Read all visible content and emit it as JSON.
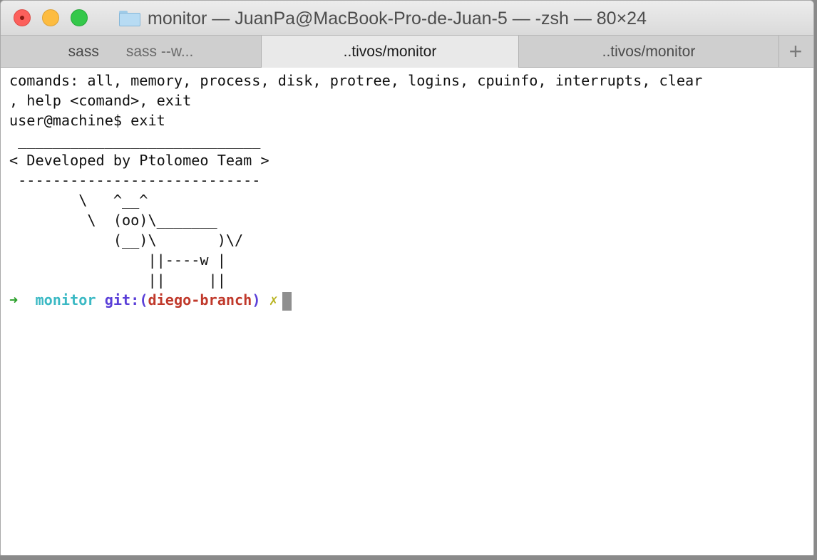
{
  "window": {
    "title": "monitor — JuanPa@MacBook-Pro-de-Juan-5 — -zsh — 80×24"
  },
  "tabs": [
    {
      "label": "sass",
      "sublabel": "sass --w...",
      "active": false
    },
    {
      "label": "..tivos/monitor",
      "active": true
    },
    {
      "label": "..tivos/monitor",
      "active": false
    }
  ],
  "new_tab_label": "+",
  "terminal": {
    "lines": [
      "comands: all, memory, process, disk, protree, logins, cpuinfo, interrupts, clear",
      ", help <comand>, exit",
      "user@machine$ exit",
      " ____________________________",
      "< Developed by Ptolomeo Team >",
      " ----------------------------",
      "        \\   ^__^",
      "         \\  (oo)\\_______",
      "            (__)\\       )\\/",
      "                ||----w |",
      "                ||     ||"
    ],
    "prompt": {
      "arrow": "➜",
      "dir": "monitor",
      "git_label": "git:(",
      "branch": "diego-branch",
      "git_close": ")",
      "dirty": "✗"
    }
  },
  "colors": {
    "arrow": "#2aa02a",
    "dir": "#3bb9c4",
    "git": "#5a3fd8",
    "branch": "#c0392b",
    "dirty": "#b8b31f"
  },
  "icons": {
    "title": "folder-icon",
    "close": "close-button",
    "minimize": "minimize-button",
    "maximize": "zoom-button"
  }
}
